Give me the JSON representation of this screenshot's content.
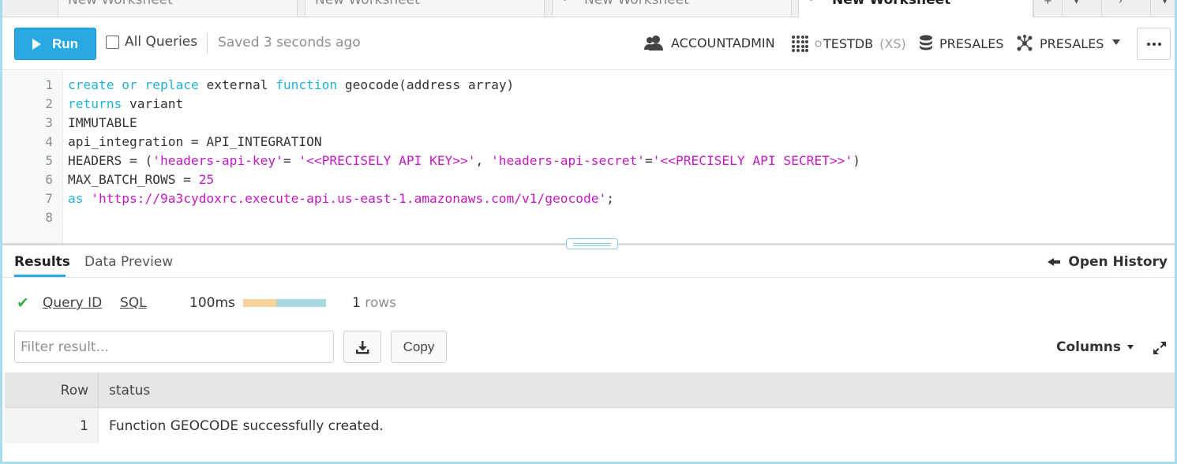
{
  "tabs": [
    {
      "label": "New Worksheet",
      "active": false,
      "check": false
    },
    {
      "label": "New Worksheet",
      "active": false,
      "check": false
    },
    {
      "label": "New Worksheet",
      "active": false,
      "check": true
    },
    {
      "label": "New Worksheet",
      "active": true,
      "check": true
    }
  ],
  "toolbar": {
    "run_label": "Run",
    "all_queries_label": "All Queries",
    "all_queries_checked": false,
    "saved_status": "Saved 3 seconds ago",
    "role": "ACCOUNTADMIN",
    "warehouse": "TESTDB",
    "warehouse_size": "(XS)",
    "database": "PRESALES",
    "schema": "PRESALES"
  },
  "editor": {
    "line_numbers": [
      "1",
      "2",
      "3",
      "4",
      "5",
      "6",
      "7",
      "8"
    ]
  },
  "results": {
    "tab_results": "Results",
    "tab_preview": "Data Preview",
    "open_history": "Open History",
    "query_id_link": "Query ID",
    "sql_link": "SQL",
    "duration": "100ms",
    "duration_queued_fraction": 0.4,
    "row_count": "1",
    "row_count_unit": "rows",
    "filter_placeholder": "Filter result...",
    "copy_label": "Copy",
    "columns_label": "Columns",
    "table": {
      "headers": [
        "Row",
        "status"
      ],
      "rows": [
        {
          "row": "1",
          "status": "Function GEOCODE successfully created."
        }
      ]
    }
  },
  "colors": {
    "accent": "#29a9e1",
    "keyword": "#1fb3d6",
    "string": "#c419c4",
    "success": "#3fae49"
  }
}
